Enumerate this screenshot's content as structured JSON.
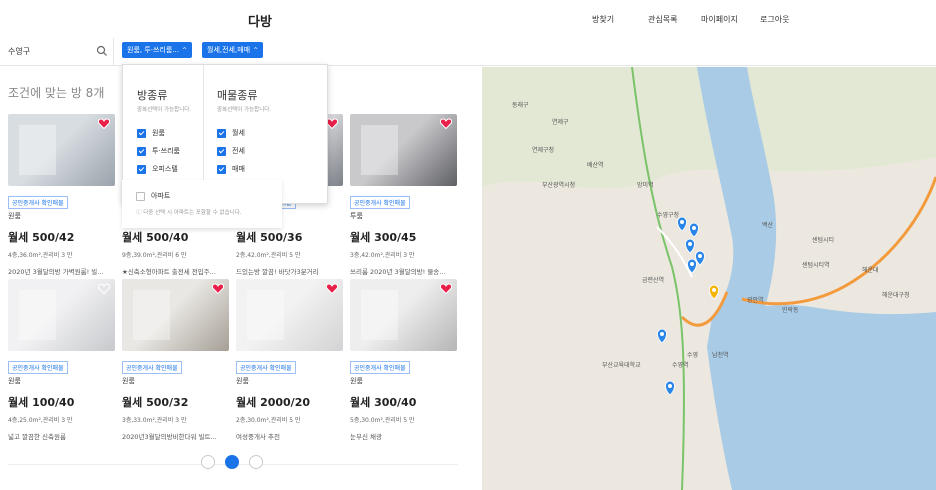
{
  "header": {
    "logo": "다방",
    "nav": [
      "방찾기",
      "관심목록",
      "마이페이지",
      "로그아웃"
    ]
  },
  "search": {
    "value": "수영구"
  },
  "filters": {
    "room_type_btn": "원룸, 투·쓰리룸...",
    "deal_type_btn": "월세,전세,매매"
  },
  "list": {
    "count_title": "조건에 맞는 방 8개"
  },
  "dropdown": {
    "room": {
      "title": "방종류",
      "sub": "중복선택이 가능합니다.",
      "options": [
        {
          "label": "원룸",
          "checked": true
        },
        {
          "label": "투·쓰리룸",
          "checked": true
        },
        {
          "label": "오피스텔",
          "checked": true
        },
        {
          "label": "아파트",
          "checked": false
        }
      ],
      "note": "다중 선택 시 아파트는 포함할 수 없습니다."
    },
    "deal": {
      "title": "매물종류",
      "sub": "중복선택이 가능합니다.",
      "options": [
        {
          "label": "월세",
          "checked": true
        },
        {
          "label": "전세",
          "checked": true
        },
        {
          "label": "매매",
          "checked": true
        }
      ]
    }
  },
  "cards": [
    {
      "badge": "공인중개사 확인매물",
      "type": "원룸",
      "price": "월세 500/42",
      "meta": "4층,36.0m²,관리비 3 만",
      "desc": "2020년 3월달의방 가벽원룸! 빌...",
      "liked": true
    },
    {
      "badge": "공인중개사 확인매물",
      "type": "원룸",
      "price": "월세 500/40",
      "meta": "9층,39.0m²,관리비 6 만",
      "desc": "★신축소형아파트 출전세 전입주...",
      "liked": false
    },
    {
      "badge": "공인중개사 확인매물",
      "type": "원룸",
      "price": "월세 500/36",
      "meta": "2층,42.0m²,관리비 5 만",
      "desc": "드있는방 깔끔! 바닷가3분거리",
      "liked": true
    },
    {
      "badge": "공인중개사 확인매물",
      "type": "투룸",
      "price": "월세 300/45",
      "meta": "3층,42.0m²,관리비 3 만",
      "desc": "쓰리룸 2020년 3월달의방! 물송...",
      "liked": true
    },
    {
      "badge": "공인중개사 확인매물",
      "type": "원룸",
      "price": "월세 100/40",
      "meta": "4층,25.0m²,관리비 3 만",
      "desc": "넓고 깔끔한 신축원룸",
      "liked": false
    },
    {
      "badge": "공인중개사 확인매물",
      "type": "원룸",
      "price": "월세 500/32",
      "meta": "3층,33.0m²,관리비 3 만",
      "desc": "2020년3월달의방비한다워 빌트...",
      "liked": true
    },
    {
      "badge": "공인중개사 확인매물",
      "type": "원룸",
      "price": "월세 2000/20",
      "meta": "2층,30.0m²,관리비 5 만",
      "desc": "여성중개사 추천",
      "liked": true
    },
    {
      "badge": "공인중개사 확인매물",
      "type": "원룸",
      "price": "월세 300/40",
      "meta": "5층,30.0m²,관리비 5 만",
      "desc": "눈부신 채광",
      "liked": true
    }
  ],
  "pagination": {
    "current": 2,
    "pages": 3
  },
  "map": {
    "labels": [
      {
        "t": "연제구"
      },
      {
        "t": "연제구청"
      },
      {
        "t": "수영구청"
      },
      {
        "t": "수영역"
      },
      {
        "t": "수영"
      },
      {
        "t": "백산"
      },
      {
        "t": "센텀시티"
      },
      {
        "t": "민락동"
      },
      {
        "t": "광안역"
      },
      {
        "t": "해운대"
      },
      {
        "t": "센텀시티역"
      },
      {
        "t": "해운대구청"
      },
      {
        "t": "망미역"
      },
      {
        "t": "배산역"
      },
      {
        "t": "남천역"
      },
      {
        "t": "금련산역"
      },
      {
        "t": "부산교육대학교"
      },
      {
        "t": "부산광역시청"
      },
      {
        "t": "동래구"
      }
    ]
  }
}
